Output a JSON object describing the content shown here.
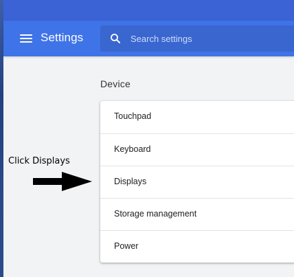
{
  "header": {
    "title": "Settings",
    "search": {
      "placeholder": "Search settings",
      "value": ""
    }
  },
  "section": {
    "title": "Device",
    "items": [
      {
        "label": "Touchpad"
      },
      {
        "label": "Keyboard"
      },
      {
        "label": "Displays"
      },
      {
        "label": "Storage management"
      },
      {
        "label": "Power"
      }
    ]
  },
  "annotation": {
    "text": "Click Displays"
  },
  "colors": {
    "header": "#3f73e8",
    "window_top": "#3b63d6",
    "background": "#f1f3f4"
  },
  "icons": {
    "menu": "hamburger-menu-icon",
    "search": "search-icon",
    "arrow": "arrow-right-icon"
  }
}
